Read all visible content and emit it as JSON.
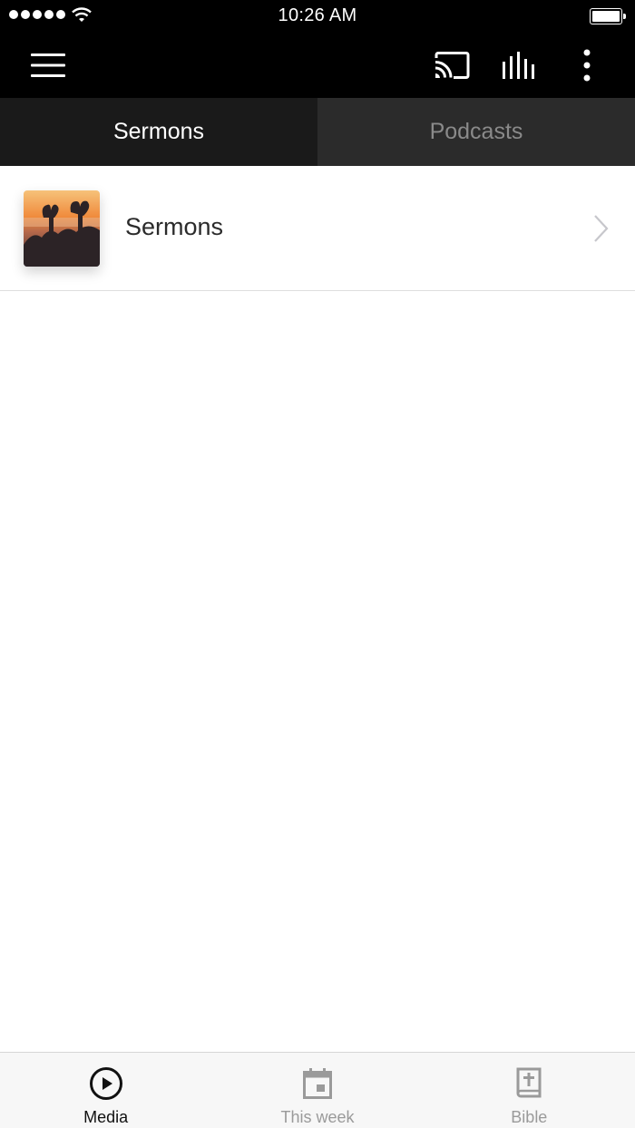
{
  "status_bar": {
    "time": "10:26 AM",
    "signal_bars": 5,
    "battery_level": 1.0
  },
  "app_bar": {
    "icons": [
      "menu-icon",
      "cast-icon",
      "equalizer-icon",
      "more-vert-icon"
    ],
    "background": "#000000"
  },
  "tabs": [
    {
      "label": "Sermons",
      "active": true
    },
    {
      "label": "Podcasts",
      "active": false
    }
  ],
  "list": {
    "items": [
      {
        "label": "Sermons",
        "thumbnail": "sermons-thumbnail"
      }
    ]
  },
  "bottom_nav": {
    "items": [
      {
        "label": "Media",
        "icon": "play-circle-icon",
        "active": true
      },
      {
        "label": "This week",
        "icon": "calendar-icon",
        "active": false
      },
      {
        "label": "Bible",
        "icon": "bible-icon",
        "active": false
      }
    ]
  },
  "colors": {
    "tab_active_bg": "#1a1a1a",
    "tab_inactive_bg": "#2b2b2b",
    "nav_active": "#111111",
    "nav_inactive": "#9a9a9a"
  }
}
